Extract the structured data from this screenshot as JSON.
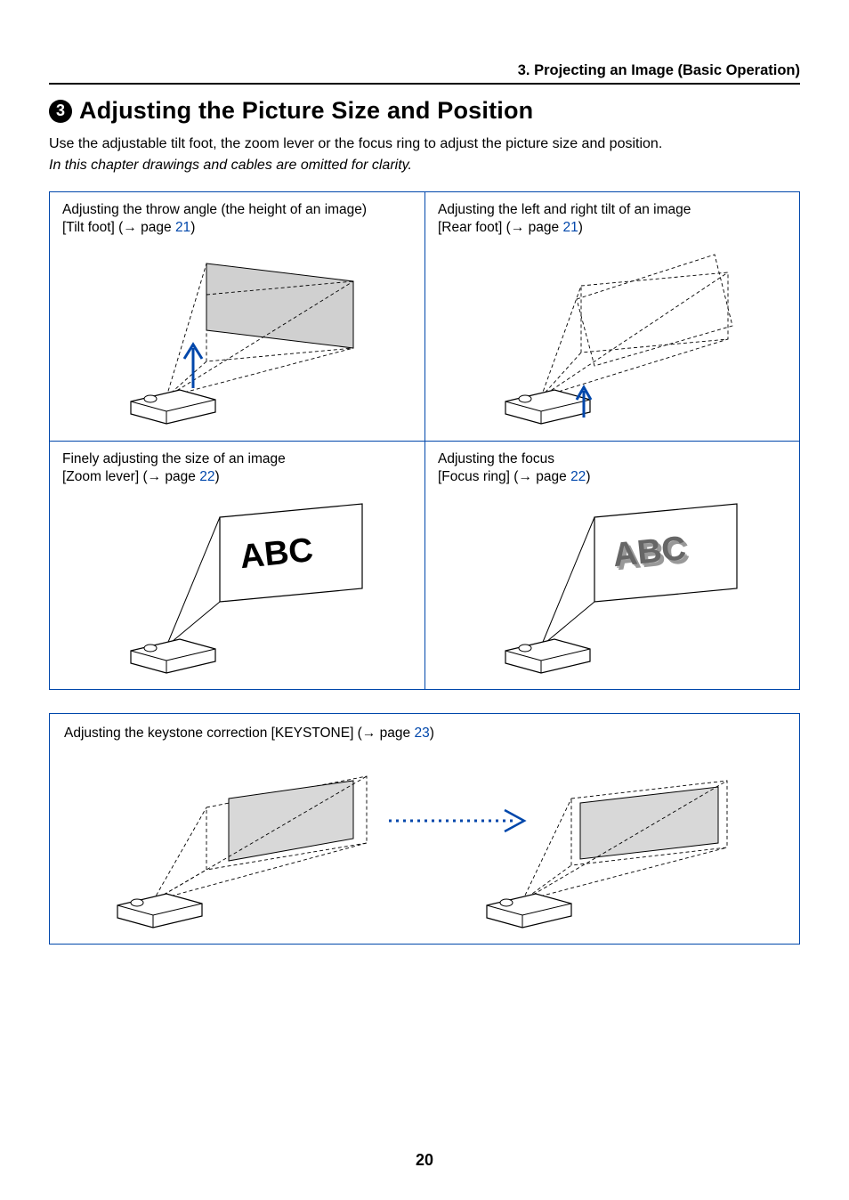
{
  "header": {
    "chapter": "3. Projecting an Image (Basic Operation)"
  },
  "section": {
    "number": "3",
    "title": "Adjusting the Picture Size and Position",
    "intro": "Use the adjustable tilt foot, the zoom lever or the focus ring to adjust the picture size and position.",
    "intro_italic": "In this chapter drawings and cables are omitted for clarity."
  },
  "cells": {
    "tl": {
      "title": "Adjusting the throw angle (the height of an image)",
      "control": "[Tilt foot] (",
      "arrow": "→",
      "page_word": " page ",
      "page": "21",
      "close": ")"
    },
    "tr": {
      "title": "Adjusting the left and right tilt of an image",
      "control": "[Rear foot] (",
      "arrow": "→",
      "page_word": " page ",
      "page": "21",
      "close": ")"
    },
    "bl": {
      "title": "Finely adjusting the size of an image",
      "control": "[Zoom lever] (",
      "arrow": "→",
      "page_word": " page ",
      "page": "22",
      "close": ")"
    },
    "br": {
      "title": "Adjusting the focus",
      "control": "[Focus ring] (",
      "arrow": "→",
      "page_word": " page ",
      "page": "22",
      "close": ")"
    }
  },
  "keystone": {
    "title": "Adjusting the keystone correction [KEYSTONE] (",
    "arrow": "→",
    "page_word": " page ",
    "page": "23",
    "close": ")"
  },
  "sample_text": "ABC",
  "page_number": "20"
}
